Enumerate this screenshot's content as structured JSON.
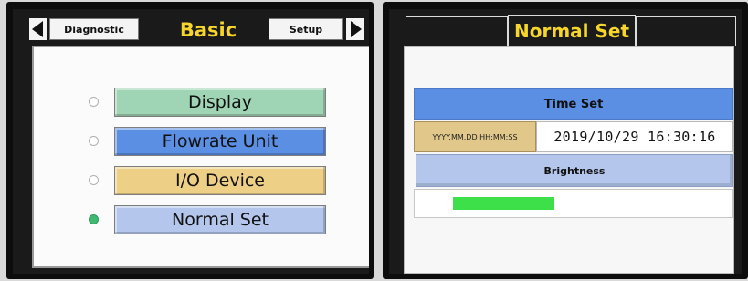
{
  "left_screen": {
    "nav": {
      "prev_tab_label": "Diagnostic",
      "title": "Basic",
      "next_tab_label": "Setup",
      "prev_arrow_icon": "triangle-left-icon",
      "next_arrow_icon": "triangle-right-icon"
    },
    "menu": [
      {
        "label": "Display",
        "color": "#9fd4b4",
        "selected": false
      },
      {
        "label": "Flowrate Unit",
        "color": "#5b8fe3",
        "selected": false
      },
      {
        "label": "I/O Device",
        "color": "#edcf86",
        "selected": false
      },
      {
        "label": "Normal Set",
        "color": "#b4c6ec",
        "selected": true
      }
    ],
    "accent_title_color": "#f6d62a",
    "selected_radio_color": "#3fb872"
  },
  "right_screen": {
    "title": "Normal Set",
    "time_set": {
      "header": "Time Set",
      "format_label": "YYYY.MM.DD HH:MM:SS",
      "value": "2019/10/29  16:30:16"
    },
    "brightness": {
      "header": "Brightness",
      "level_fraction": 0.42,
      "fill_color": "#3ee04a"
    }
  }
}
